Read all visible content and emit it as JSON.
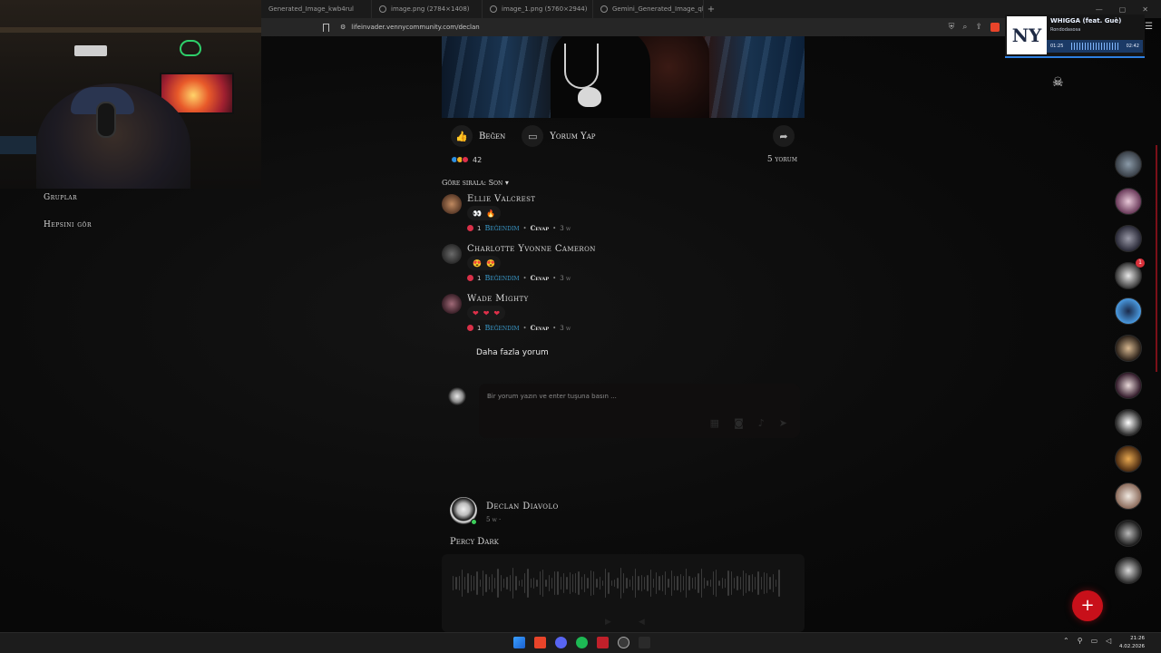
{
  "browser": {
    "tabs": [
      {
        "title": "Generated_Image_kwb4rul"
      },
      {
        "title": "image.png (2784×1408)"
      },
      {
        "title": "image_1.png (5760×2944)"
      },
      {
        "title": "Gemini_Generated_Image_qhdbzqrg"
      }
    ],
    "new_tab": "+",
    "url": "lifeinvader.vennycommunity.com/declan"
  },
  "sidebar": {
    "groups_label": "Gruplar",
    "see_all_label": "Hepsini gör"
  },
  "post1": {
    "like_label": "Beğen",
    "comment_label": "Yorum Yap",
    "reaction_count": "42",
    "comments_count": "5 yorum",
    "sort_label": "Göre sırala: Son ▾",
    "reaction_colors": [
      "#2d8fe0",
      "#f0b020",
      "#e0304a"
    ]
  },
  "comments": [
    {
      "name": "Ellie Valcrest",
      "emojis": [
        "👀",
        "🔥"
      ],
      "likes": "1",
      "liked_label": "Beğendim",
      "reply_label": "Cevap",
      "time": "3 w"
    },
    {
      "name": "Charlotte Yvonne Cameron",
      "emojis": [
        "😍",
        "😍"
      ],
      "likes": "1",
      "liked_label": "Beğendim",
      "reply_label": "Cevap",
      "time": "3 w"
    },
    {
      "name": "Wade Mighty",
      "emojis": [
        "❤",
        "❤",
        "❤"
      ],
      "likes": "1",
      "liked_label": "Beğendim",
      "reply_label": "Cevap",
      "time": "3 w"
    }
  ],
  "more_comments_label": "Daha fazla yorum",
  "comment_input": {
    "placeholder": "Bir yorum yazın ve enter tuşuna basın ..."
  },
  "post2": {
    "author": "Declan Diavolo",
    "time": "5 w ·",
    "text": "Percy Dark"
  },
  "music": {
    "title": "WHIGGA (feat. Guè)",
    "artist": "Rondodasosa",
    "elapsed": "01:25",
    "total": "02:42",
    "cover_text": "NY"
  },
  "right_rail": {
    "notification_badge": "1"
  },
  "fab_label": "+",
  "taskbar": {
    "time": "21:26",
    "date": "4.02.2026"
  }
}
